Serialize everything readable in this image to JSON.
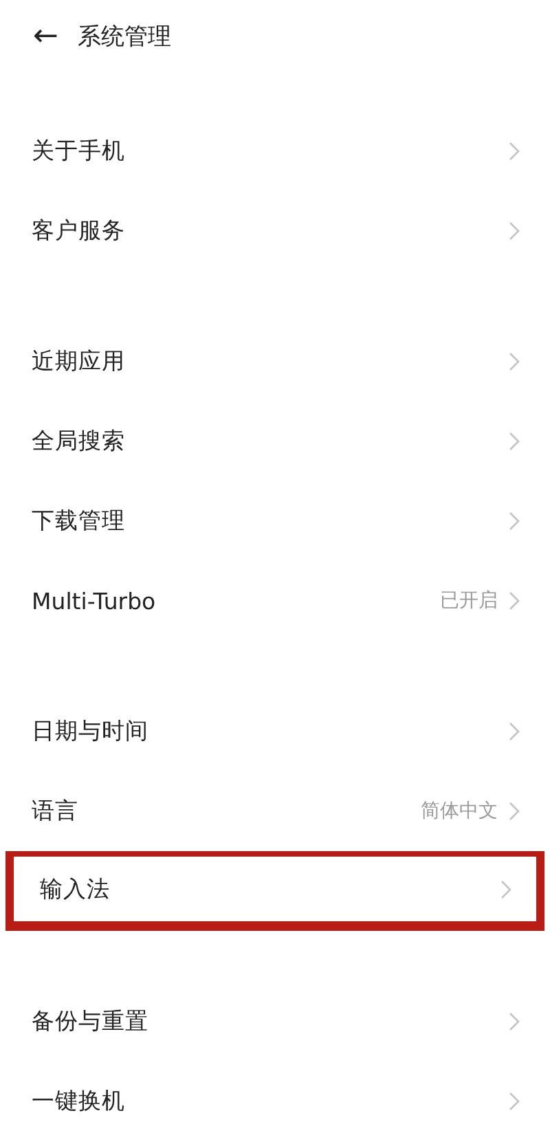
{
  "header": {
    "back": "←",
    "title": "系统管理"
  },
  "groups": [
    {
      "items": [
        {
          "label": "关于手机",
          "highlighted": false
        },
        {
          "label": "客户服务",
          "highlighted": false
        }
      ]
    },
    {
      "items": [
        {
          "label": "近期应用",
          "highlighted": false
        },
        {
          "label": "全局搜索",
          "highlighted": false
        },
        {
          "label": "下载管理",
          "highlighted": false
        },
        {
          "label": "Multi-Turbo",
          "value": "已开启",
          "highlighted": false
        }
      ]
    },
    {
      "items": [
        {
          "label": "日期与时间",
          "highlighted": false
        },
        {
          "label": "语言",
          "value": "简体中文",
          "highlighted": false
        },
        {
          "label": "输入法",
          "highlighted": true
        }
      ]
    },
    {
      "items": [
        {
          "label": "备份与重置",
          "highlighted": false
        },
        {
          "label": "一键换机",
          "highlighted": false
        }
      ]
    }
  ]
}
